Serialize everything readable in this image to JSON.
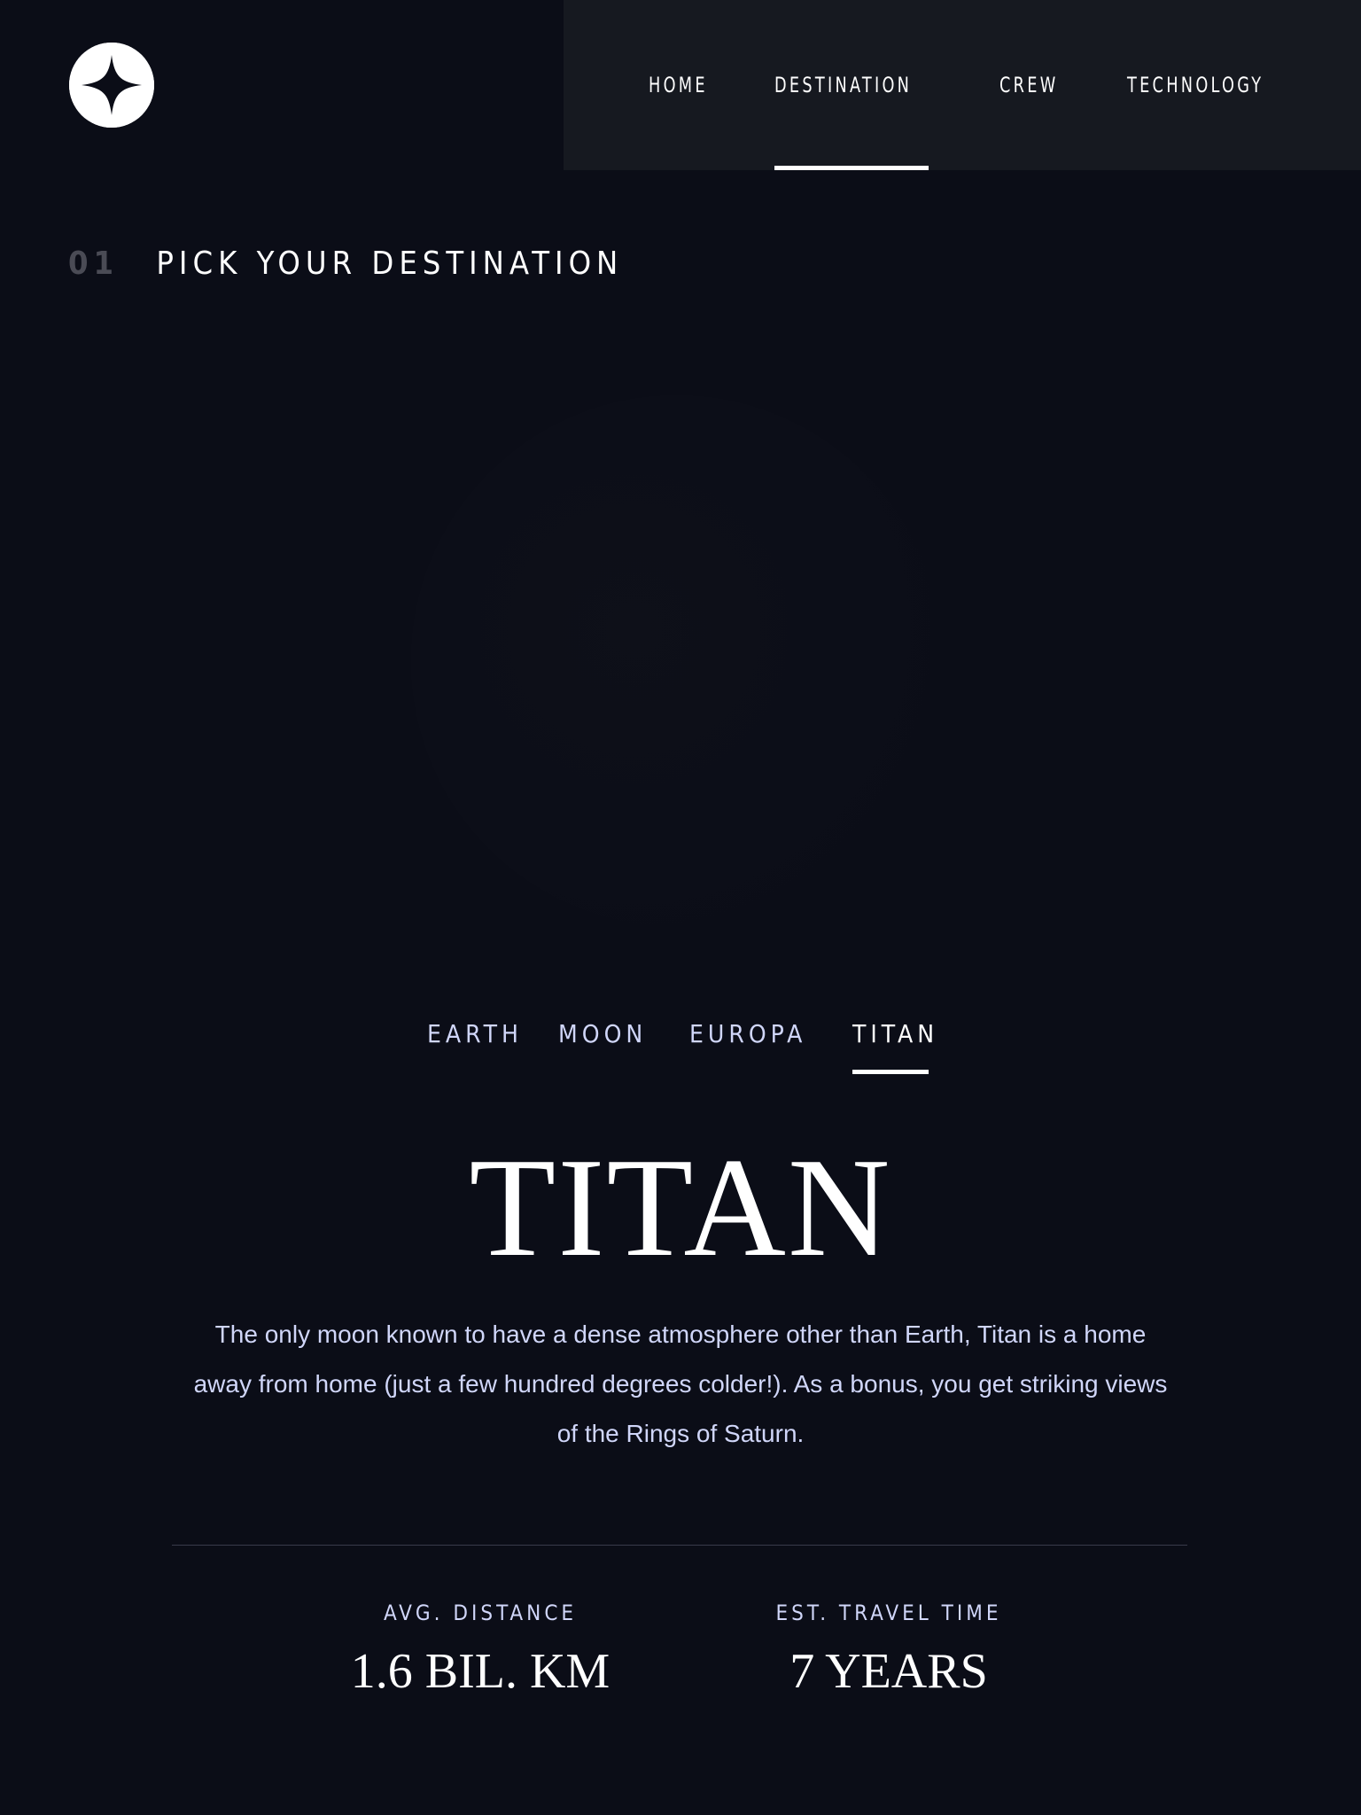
{
  "header": {
    "logo_icon": "four-point-star-icon",
    "nav": {
      "home": "HOME",
      "destination": "DESTINATION",
      "crew": "CREW",
      "technology": "TECHNOLOGY",
      "active": "destination"
    }
  },
  "section": {
    "number": "01",
    "title": "PICK YOUR DESTINATION"
  },
  "tabs": {
    "earth": "EARTH",
    "moon": "MOON",
    "europa": "EUROPA",
    "titan": "TITAN",
    "active": "titan"
  },
  "destination": {
    "name": "TITAN",
    "description": "The only moon known to have a dense atmosphere other than Earth, Titan is a home away from home (just a few hundred degrees colder!). As a bonus, you get striking views of the Rings of Saturn.",
    "stats": {
      "distance_label": "AVG. DISTANCE",
      "distance_value": "1.6 BIL. KM",
      "travel_label": "EST. TRAVEL TIME",
      "travel_value": "7 YEARS"
    }
  },
  "colors": {
    "background": "#0b0d17",
    "nav_background": "#161920",
    "accent_light": "#d0d6f9",
    "white": "#ffffff"
  }
}
